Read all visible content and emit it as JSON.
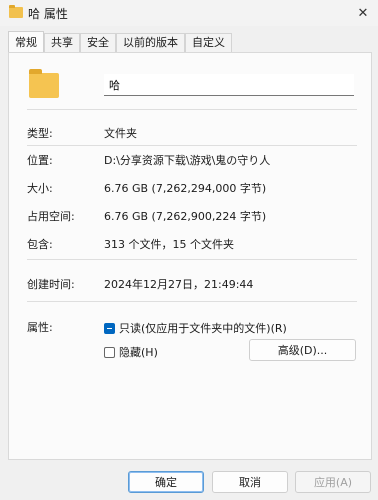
{
  "window": {
    "title": "哈 属性",
    "close_glyph": "✕"
  },
  "tabs": [
    {
      "label": "常规",
      "active": true
    },
    {
      "label": "共享"
    },
    {
      "label": "安全"
    },
    {
      "label": "以前的版本"
    },
    {
      "label": "自定义"
    }
  ],
  "general": {
    "name": "哈",
    "type": {
      "label": "类型:",
      "value": "文件夹"
    },
    "location": {
      "label": "位置:",
      "value": "D:\\分享资源下载\\游戏\\鬼の守り人"
    },
    "size": {
      "label": "大小:",
      "value": "6.76 GB (7,262,294,000 字节)"
    },
    "size_on_disk": {
      "label": "占用空间:",
      "value": "6.76 GB (7,262,900,224 字节)"
    },
    "contains": {
      "label": "包含:",
      "value": "313 个文件，15 个文件夹"
    },
    "created": {
      "label": "创建时间:",
      "value": "2024年12月27日，21:49:44"
    },
    "attributes": {
      "label": "属性:",
      "readonly": "只读(仅应用于文件夹中的文件)(R)",
      "readonly_state": "indeterminate",
      "hidden": "隐藏(H)",
      "hidden_checked": false,
      "advanced_button": "高级(D)..."
    }
  },
  "buttons": {
    "ok": "确定",
    "cancel": "取消",
    "apply": "应用(A)"
  },
  "colors": {
    "accent": "#0067c0",
    "folder": "#f5c451"
  }
}
